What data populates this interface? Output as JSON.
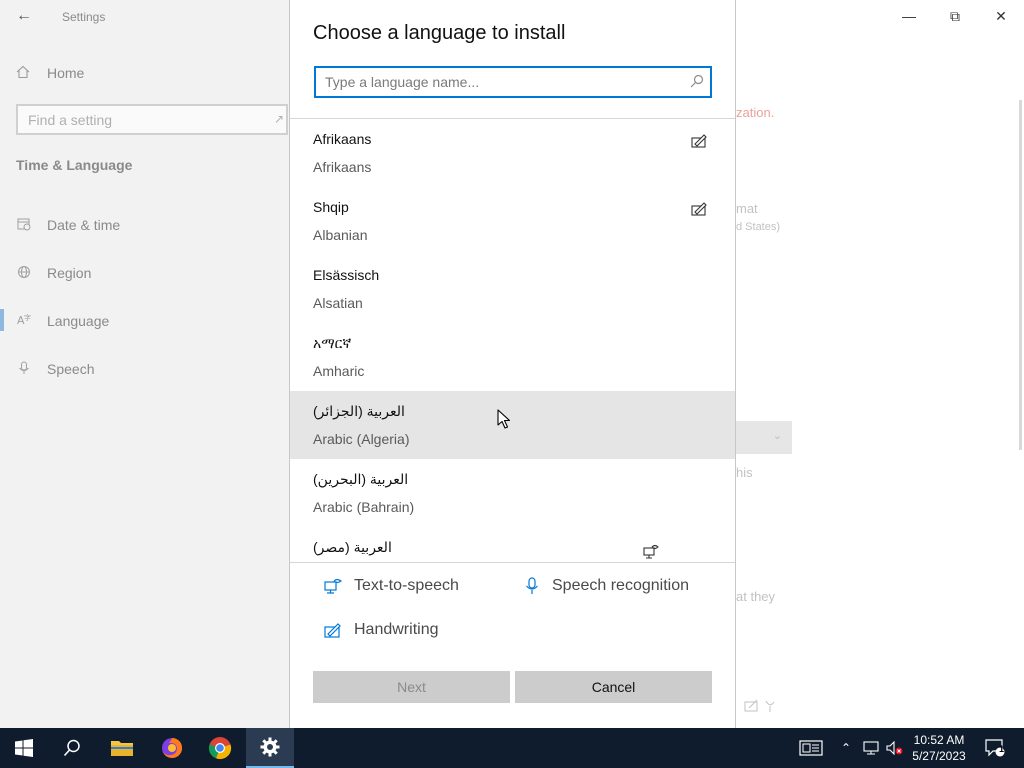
{
  "settings": {
    "window_title": "Settings",
    "home_label": "Home",
    "search_placeholder": "Find a setting",
    "section_title": "Time & Language",
    "nav": [
      {
        "label": "Date & time",
        "icon": "calendar-clock-icon"
      },
      {
        "label": "Region",
        "icon": "globe-icon"
      },
      {
        "label": "Language",
        "icon": "language-icon"
      },
      {
        "label": "Speech",
        "icon": "microphone-icon"
      }
    ],
    "background_fragments": {
      "warning": "zation.",
      "format": "mat",
      "format_sub": "d States)",
      "this": "his",
      "that_they": "at they"
    }
  },
  "dialog": {
    "title": "Choose a language to install",
    "search_placeholder": "Type a language name...",
    "languages": [
      {
        "native": "Afrikaans",
        "english": "Afrikaans",
        "feature_icon": "handwriting-icon"
      },
      {
        "native": "Shqip",
        "english": "Albanian",
        "feature_icon": "handwriting-icon"
      },
      {
        "native": "Elsässisch",
        "english": "Alsatian",
        "feature_icon": ""
      },
      {
        "native": "አማርኛ",
        "english": "Amharic",
        "feature_icon": ""
      },
      {
        "native": "العربية (الجزائر)",
        "english": "Arabic (Algeria)",
        "feature_icon": ""
      },
      {
        "native": "العربية (البحرين)",
        "english": "Arabic (Bahrain)",
        "feature_icon": ""
      },
      {
        "native": "العربية (مصر)",
        "english": "",
        "feature_icon": "text-to-speech-icon"
      }
    ],
    "legend": {
      "tts": "Text-to-speech",
      "speech": "Speech recognition",
      "handwriting": "Handwriting"
    },
    "buttons": {
      "next": "Next",
      "cancel": "Cancel"
    }
  },
  "taskbar": {
    "time": "10:52 AM",
    "date": "5/27/2023",
    "notification_count": "1",
    "accent": "#76b9ed"
  }
}
